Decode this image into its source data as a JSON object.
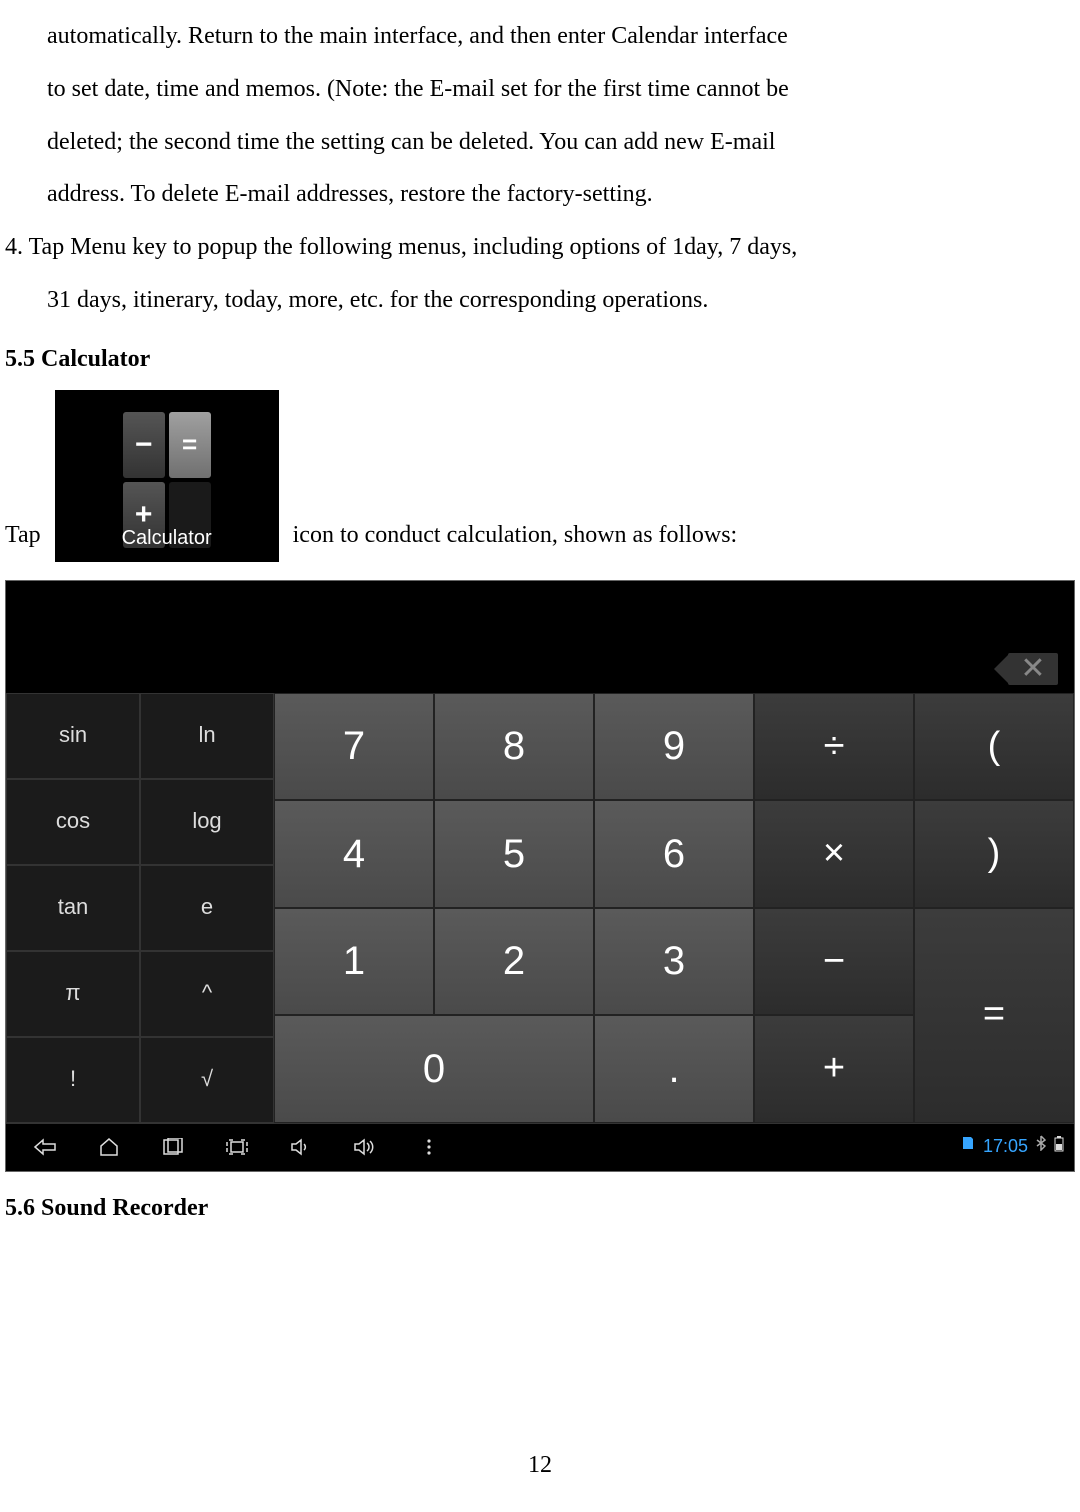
{
  "text": {
    "p1_line1": "automatically. Return to the main interface, and then enter Calendar interface",
    "p1_line2": "to set date, time and memos. (Note: the E-mail set for the first time cannot be",
    "p1_line3": "deleted; the second time the setting can be deleted. You can add new E-mail",
    "p1_line4": "address. To delete E-mail addresses, restore the factory-setting.",
    "p2_line1": "4. Tap Menu key to popup the following menus, including options of 1day, 7 days,",
    "p2_line2": "31 days, itinerary, today, more, etc. for the corresponding operations.",
    "section_calc": "5.5 Calculator",
    "tap_pre": "Tap",
    "calc_icon_label": "Calculator",
    "tap_post": "icon to conduct calculation, shown as follows:",
    "section_sound": "5.6 Sound Recorder"
  },
  "calculator": {
    "backspace": "✕",
    "sci": {
      "sin": "sin",
      "ln": "ln",
      "cos": "cos",
      "log": "log",
      "tan": "tan",
      "e": "e",
      "pi": "π",
      "pow": "^",
      "fact": "!",
      "sqrt": "√"
    },
    "num": {
      "7": "7",
      "8": "8",
      "9": "9",
      "4": "4",
      "5": "5",
      "6": "6",
      "1": "1",
      "2": "2",
      "3": "3",
      "0": "0",
      "dot": "."
    },
    "ops": {
      "div": "÷",
      "lparen": "(",
      "mul": "×",
      "rparen": ")",
      "sub": "−",
      "add": "+",
      "eq": "="
    },
    "navbar": {
      "time": "17:05"
    }
  },
  "page_number": "12"
}
